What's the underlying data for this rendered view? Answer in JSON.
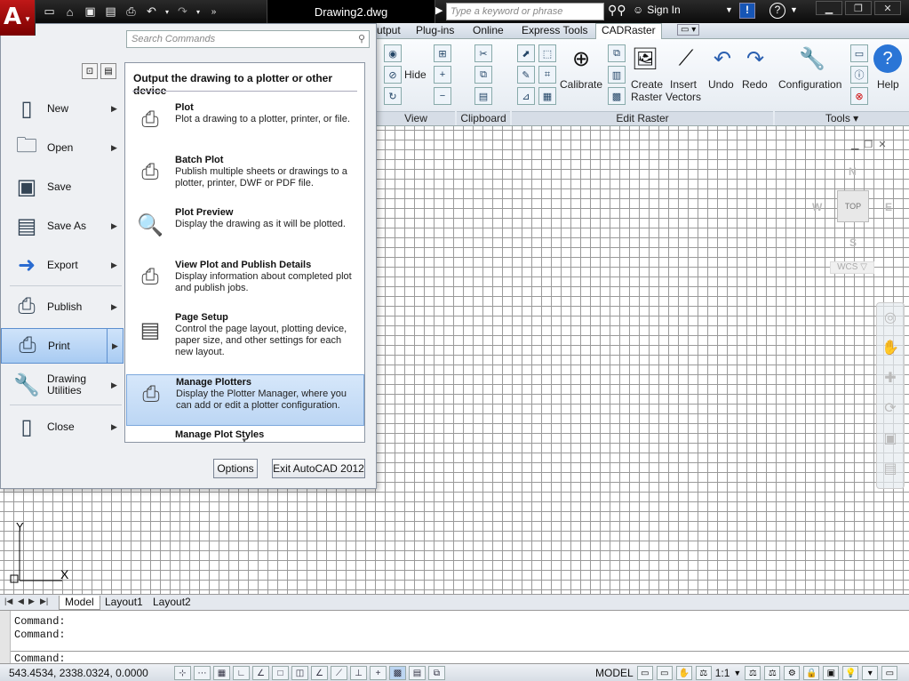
{
  "titlebar": {
    "document": "Drawing2.dwg",
    "search_placeholder": "Type a keyword or phrase",
    "sign_in": "Sign In",
    "info_glyph": "!",
    "help_glyph": "?"
  },
  "ribbon": {
    "tabs": [
      "utput",
      "Plug-ins",
      "Online",
      "Express Tools",
      "CADRaster"
    ],
    "active_tab": "CADRaster",
    "panels": {
      "view": "View",
      "clipboard": "Clipboard",
      "edit_raster": "Edit Raster",
      "tools": "Tools ▾"
    },
    "buttons": {
      "hide": "Hide",
      "calibrate": "Calibrate",
      "create_raster_1": "Create",
      "create_raster_2": "Raster",
      "insert_vectors_1": "Insert",
      "insert_vectors_2": "Vectors",
      "undo": "Undo",
      "redo": "Redo",
      "configuration": "Configuration",
      "help": "Help"
    }
  },
  "app_menu": {
    "search_placeholder": "Search Commands",
    "left_items": [
      {
        "label": "New",
        "icon": "new-document-icon"
      },
      {
        "label": "Open",
        "icon": "open-folder-icon"
      },
      {
        "label": "Save",
        "icon": "save-icon"
      },
      {
        "label": "Save As",
        "icon": "save-as-icon"
      },
      {
        "label": "Export",
        "icon": "export-icon"
      },
      {
        "label": "Publish",
        "icon": "publish-icon"
      },
      {
        "label": "Print",
        "icon": "print-icon"
      },
      {
        "label": "Drawing",
        "label2": "Utilities",
        "icon": "drawing-utilities-icon"
      },
      {
        "label": "Close",
        "icon": "close-document-icon"
      }
    ],
    "active_left": "Print",
    "right_header": "Output the drawing to a plotter or other device",
    "right_items": [
      {
        "title": "Plot",
        "desc": "Plot a drawing to a plotter, printer, or file."
      },
      {
        "title": "Batch Plot",
        "desc": "Publish multiple sheets or drawings to a plotter, printer, DWF or PDF file."
      },
      {
        "title": "Plot Preview",
        "desc": "Display the drawing as it will be plotted."
      },
      {
        "title": "View Plot and Publish Details",
        "desc": "Display information about completed plot and publish jobs."
      },
      {
        "title": "Page Setup",
        "desc": "Control the page layout, plotting device, paper size, and other settings for each new layout."
      },
      {
        "title": "Manage Plotters",
        "desc": "Display the Plotter Manager, where you can add or edit a plotter configuration."
      },
      {
        "title": "Manage Plot Styles",
        "desc": ""
      }
    ],
    "active_right": "Manage Plotters",
    "options_button": "Options",
    "exit_button": "Exit AutoCAD 2012"
  },
  "viewcube": {
    "north": "N",
    "south": "S",
    "east": "E",
    "west": "W",
    "face": "TOP",
    "wcs": "WCS ▽"
  },
  "ucs": {
    "y": "Y",
    "x": "X"
  },
  "layout_tabs": [
    "Model",
    "Layout1",
    "Layout2"
  ],
  "active_layout": "Model",
  "command": {
    "lines": [
      "Command:",
      "Command:"
    ],
    "prompt": "Command:"
  },
  "status": {
    "coordinates": "543.4534,  2338.0324, 0.0000",
    "model": "MODEL",
    "scale": "1:1"
  }
}
